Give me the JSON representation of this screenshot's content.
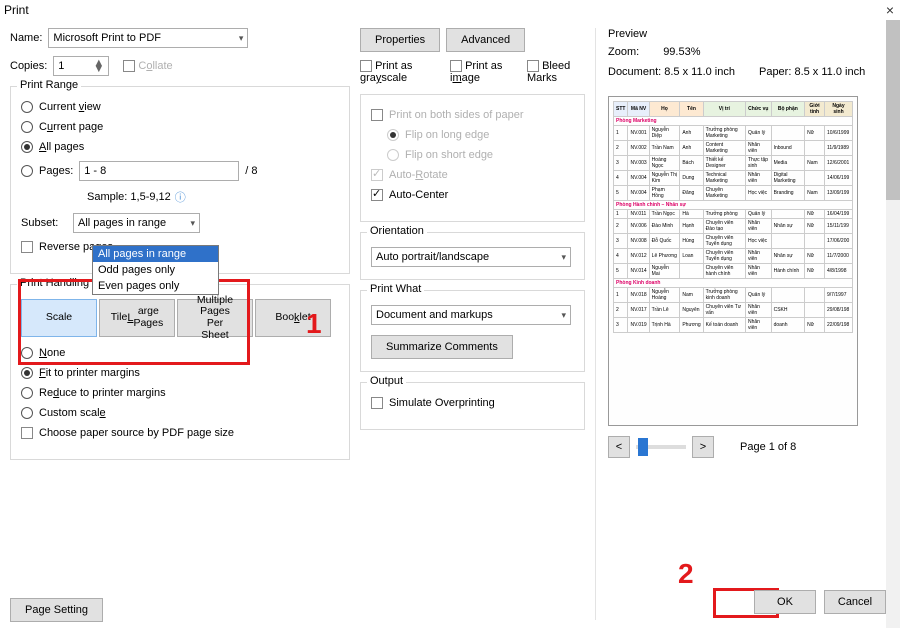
{
  "window": {
    "title": "Print"
  },
  "top": {
    "name_label": "Name:",
    "printer": "Microsoft Print to PDF",
    "properties": "Properties",
    "advanced": "Advanced",
    "copies_label": "Copies:",
    "copies_value": "1",
    "collate": "Collate",
    "grayscale": "Print as grayscale",
    "as_image": "Print as image",
    "bleed": "Bleed Marks"
  },
  "range": {
    "title": "Print Range",
    "current_view": "Current view",
    "current_page": "Current page",
    "all_pages": "All pages",
    "pages_label": "Pages:",
    "pages_value": "1 - 8",
    "total": "/ 8",
    "sample": "Sample: 1,5-9,12",
    "subset_label": "Subset:",
    "subset_value": "All pages in range",
    "subset_options": {
      "a": "All pages in range",
      "b": "Odd pages only",
      "c": "Even pages only"
    },
    "reverse": "Reverse pages"
  },
  "midtop": {
    "both_sides": "Print on both sides of paper",
    "long_edge": "Flip on long edge",
    "short_edge": "Flip on short edge",
    "auto_rotate": "Auto-Rotate",
    "auto_center": "Auto-Center"
  },
  "handling": {
    "title": "Print Handling",
    "scale": "Scale",
    "tile": "Tile Large Pages",
    "multi": "Multiple Pages Per Sheet",
    "booklet": "Booklet",
    "none": "None",
    "fit": "Fit to printer margins",
    "reduce": "Reduce to printer margins",
    "custom": "Custom scale",
    "paper_source": "Choose paper source by PDF page size"
  },
  "orientation": {
    "title": "Orientation",
    "value": "Auto portrait/landscape"
  },
  "printwhat": {
    "title": "Print What",
    "value": "Document and markups",
    "summarize": "Summarize Comments"
  },
  "output": {
    "title": "Output",
    "simulate": "Simulate Overprinting"
  },
  "preview": {
    "title": "Preview",
    "zoom_label": "Zoom:",
    "zoom_value": "99.53%",
    "doc_label": "Document: 8.5 x 11.0 inch",
    "paper_label": "Paper: 8.5 x 11.0 inch",
    "page_of": "Page 1 of 8"
  },
  "footer": {
    "page_setting": "Page Setting",
    "ok": "OK",
    "cancel": "Cancel"
  },
  "annotations": {
    "n1": "1",
    "n2": "2"
  },
  "preview_table": {
    "headers": {
      "stt": "STT",
      "manv": "Mã NV",
      "ho": "Họ",
      "ten": "Tên",
      "vitri": "Vị trí",
      "chucvu": "Chức vụ",
      "bophan": "Bộ phận",
      "gioitinh": "Giới tính",
      "ngaysinh": "Ngày sinh"
    },
    "sections": {
      "s1": "Phòng Marketing",
      "s2": "Phòng Hành chính – Nhân sự",
      "s3": "Phòng Kinh doanh"
    }
  }
}
